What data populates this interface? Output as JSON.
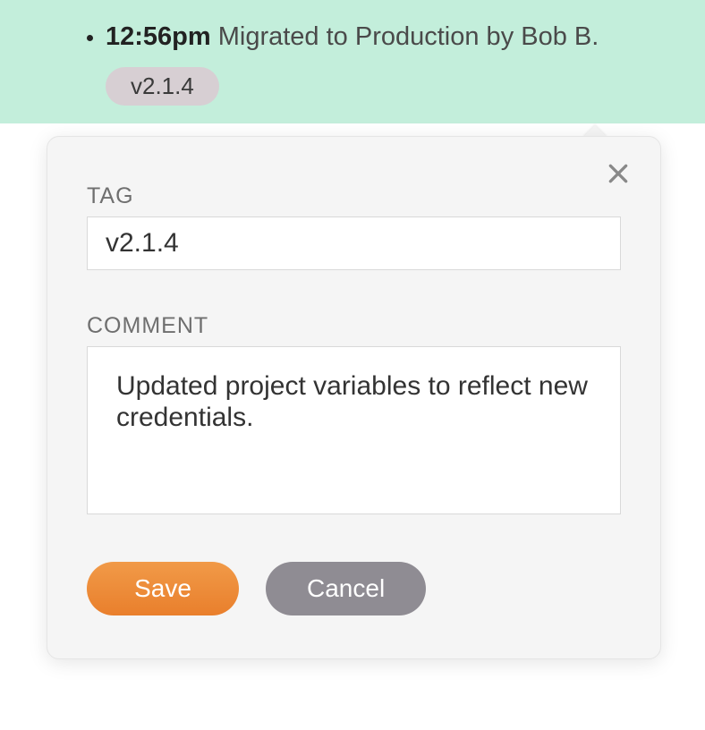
{
  "log": {
    "time": "12:56pm",
    "message": "Migrated to Production by Bob B.",
    "tag": "v2.1.4"
  },
  "popover": {
    "tag_label": "TAG",
    "tag_value": "v2.1.4",
    "comment_label": "COMMENT",
    "comment_value": "Updated project variables to reflect new credentials.",
    "save_label": "Save",
    "cancel_label": "Cancel"
  }
}
